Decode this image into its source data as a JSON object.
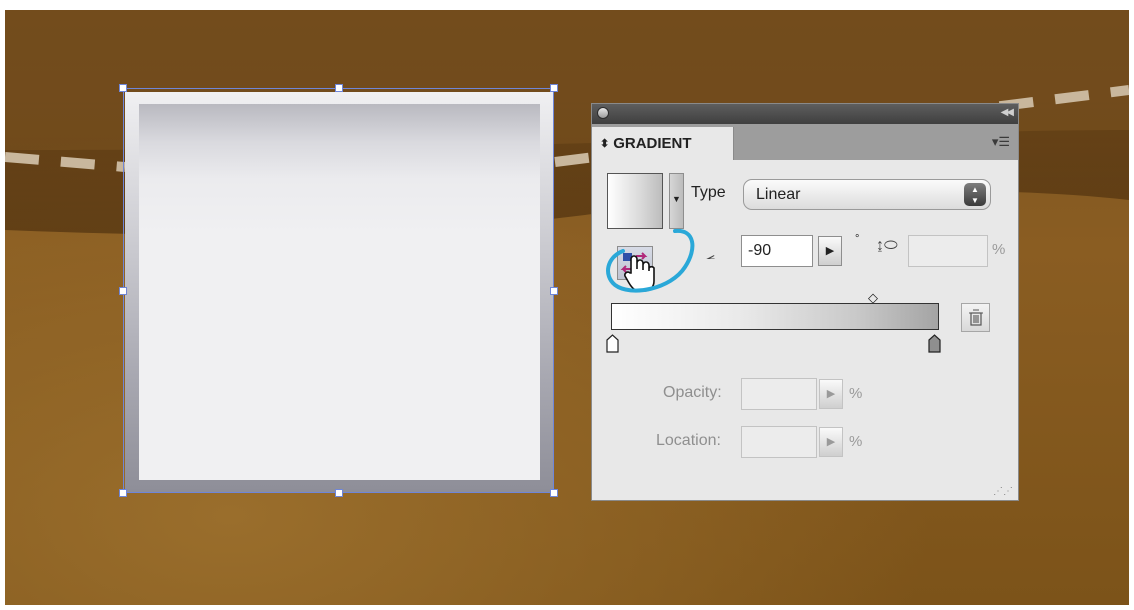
{
  "panel": {
    "tab_label": "GRADIENT",
    "type_label": "Type",
    "type_value": "Linear",
    "angle_value": "-90",
    "degree_symbol": "°",
    "aspect_value": "",
    "percent_symbol": "%",
    "opacity_label": "Opacity:",
    "location_label": "Location:",
    "opacity_value": "",
    "location_value": ""
  },
  "gradient": {
    "start_color": "#ffffff",
    "end_color": "#a4a4a4"
  },
  "colors": {
    "background": "#7c5319",
    "selection": "#6f86d8",
    "annotation": "#2aa8d8"
  },
  "icons": {
    "reverse": "reverse-gradient-icon",
    "cursor": "hand-cursor-icon",
    "angle": "angle-icon",
    "aspect": "aspect-ratio-icon",
    "trash": "trash-icon",
    "menu": "panel-menu-icon"
  }
}
